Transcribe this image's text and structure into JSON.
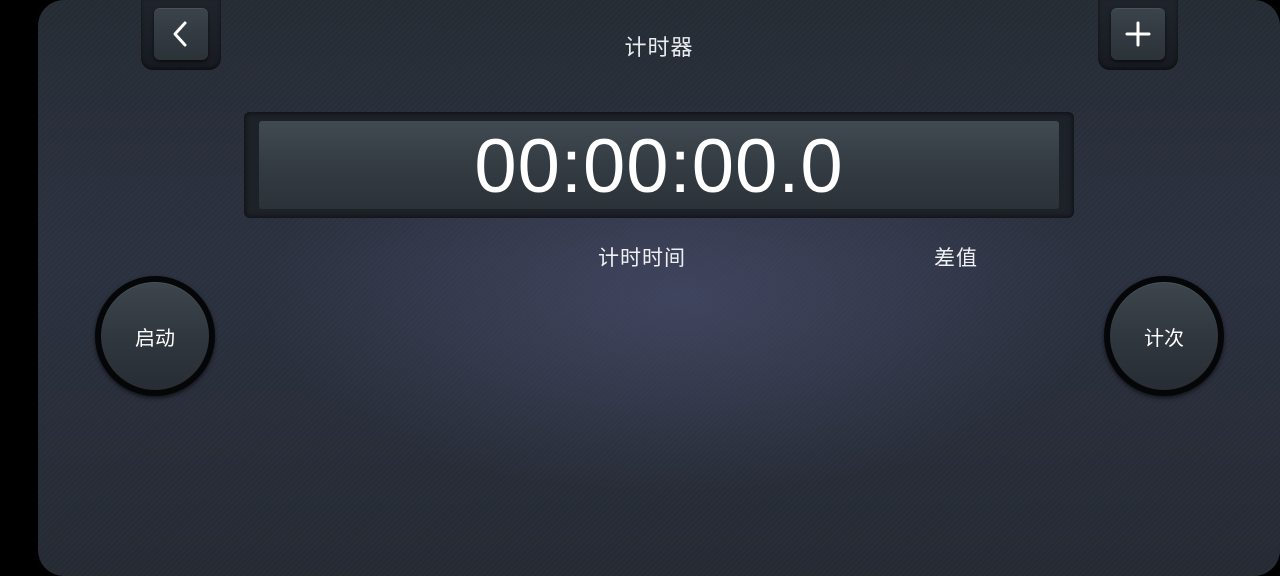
{
  "header": {
    "title": "计时器",
    "back_icon": "chevron-left-icon",
    "add_icon": "plus-icon"
  },
  "display": {
    "time": "00:00:00.0"
  },
  "columns": {
    "timing_time": "计时时间",
    "difference": "差值"
  },
  "controls": {
    "start_label": "启动",
    "lap_label": "计次"
  },
  "colors": {
    "text": "#ffffff",
    "background": "#2a2f3a"
  }
}
